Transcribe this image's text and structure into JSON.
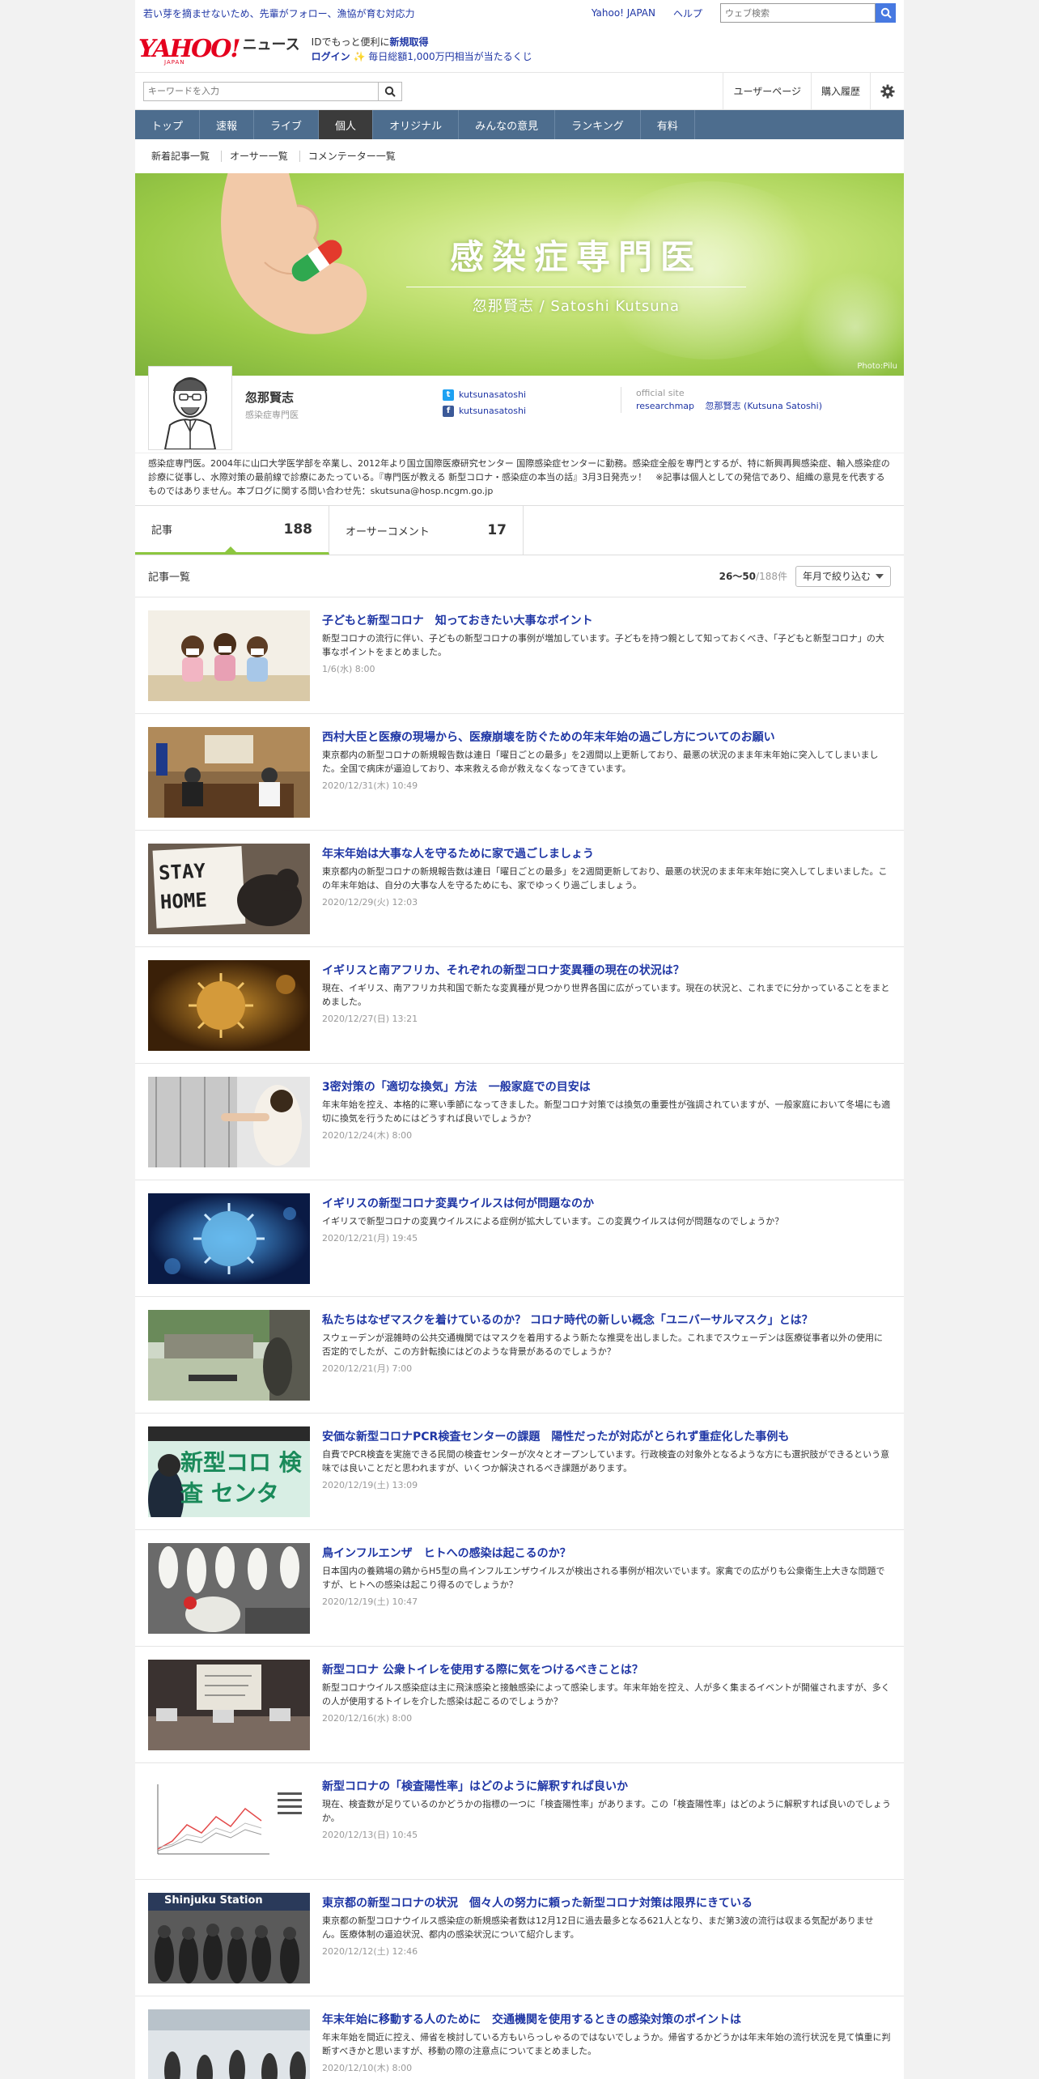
{
  "topbar": {
    "promo": "若い芽を摘ませないため、先輩がフォロー、漁協が育む対応力",
    "yahoo_japan": "Yahoo! JAPAN",
    "help": "ヘルプ",
    "web_search_placeholder": "ウェブ検索"
  },
  "header": {
    "logo_text": "YAHOO!",
    "logo_sub": "JAPAN",
    "news_label": "ニュース",
    "id_prefix": "IDでもっと便利に",
    "id_register": "新規取得",
    "login": "ログイン",
    "lottery": "毎日総額1,000万円相当が当たるくじ"
  },
  "search": {
    "placeholder": "キーワードを入力",
    "user_page": "ユーザーページ",
    "purchase_history": "購入履歴"
  },
  "nav": {
    "items": [
      "トップ",
      "速報",
      "ライブ",
      "個人",
      "オリジナル",
      "みんなの意見",
      "ランキング",
      "有料"
    ],
    "active": "個人"
  },
  "subnav": {
    "items": [
      "新着記事一覧",
      "オーサー一覧",
      "コメンテーター一覧"
    ]
  },
  "banner": {
    "title": "感染症専門医",
    "subtitle": "忽那賢志 / Satoshi Kutsuna",
    "credit": "Photo:Pilu"
  },
  "profile": {
    "name": "忽那賢志",
    "role": "感染症専門医",
    "twitter": "kutsunasatoshi",
    "facebook": "kutsunasatoshi",
    "official_label": "official site",
    "official_links": [
      "researchmap",
      "忽那賢志 (Kutsuna Satoshi)"
    ],
    "bio": "感染症専門医。2004年に山口大学医学部を卒業し、2012年より国立国際医療研究センター 国際感染症センターに勤務。感染症全般を専門とするが、特に新興再興感染症、輸入感染症の診療に従事し、水際対策の最前線で診療にあたっている。『専門医が教える 新型コロナ・感染症の本当の話』3月3日発売ッ！　※記事は個人としての発信であり、組織の意見を代表するものではありません。本ブログに関する問い合わせ先：skutsuna@hosp.ncgm.go.jp"
  },
  "tabs": [
    {
      "label": "記事",
      "count": "188"
    },
    {
      "label": "オーサーコメント",
      "count": "17"
    }
  ],
  "list": {
    "title": "記事一覧",
    "range": "26～50",
    "total": "/188件",
    "filter": "年月で絞り込む"
  },
  "articles": [
    {
      "title": "子どもと新型コロナ　知っておきたい大事なポイント",
      "summary": "新型コロナの流行に伴い、子どもの新型コロナの事例が増加しています。子どもを持つ親として知っておくべき、「子どもと新型コロナ」の大事なポイントをまとめました。",
      "date": "1/6(水) 8:00"
    },
    {
      "title": "西村大臣と医療の現場から、医療崩壊を防ぐための年末年始の過ごし方についてのお願い",
      "summary": "東京都内の新型コロナの新規報告数は連日「曜日ごとの最多」を2週間以上更新しており、最悪の状況のまま年末年始に突入してしまいました。全国で病床が逼迫しており、本来救える命が救えなくなってきています。",
      "date": "2020/12/31(木) 10:49"
    },
    {
      "title": "年末年始は大事な人を守るために家で過ごしましょう",
      "summary": "東京都内の新型コロナの新規報告数は連日「曜日ごとの最多」を2週間更新しており、最悪の状況のまま年末年始に突入してしまいました。この年末年始は、自分の大事な人を守るためにも、家でゆっくり過ごしましょう。",
      "date": "2020/12/29(火) 12:03"
    },
    {
      "title": "イギリスと南アフリカ、それぞれの新型コロナ変異種の現在の状況は？",
      "summary": "現在、イギリス、南アフリカ共和国で新たな変異種が見つかり世界各国に広がっています。現在の状況と、これまでに分かっていることをまとめました。",
      "date": "2020/12/27(日) 13:21"
    },
    {
      "title": "3密対策の「適切な換気」方法　一般家庭での目安は",
      "summary": "年末年始を控え、本格的に寒い季節になってきました。新型コロナ対策では換気の重要性が強調されていますが、一般家庭において冬場にも適切に換気を行うためにはどうすれば良いでしょうか？",
      "date": "2020/12/24(木) 8:00"
    },
    {
      "title": "イギリスの新型コロナ変異ウイルスは何が問題なのか",
      "summary": "イギリスで新型コロナの変異ウイルスによる症例が拡大しています。この変異ウイルスは何が問題なのでしょうか？",
      "date": "2020/12/21(月) 19:45"
    },
    {
      "title": "私たちはなぜマスクを着けているのか？ コロナ時代の新しい概念「ユニバーサルマスク」とは？",
      "summary": "スウェーデンが混雑時の公共交通機関ではマスクを着用するよう新たな推奨を出しました。これまでスウェーデンは医療従事者以外の使用に否定的でしたが、この方針転換にはどのような背景があるのでしょうか？",
      "date": "2020/12/21(月) 7:00"
    },
    {
      "title": "安価な新型コロナPCR検査センターの課題　陽性だったが対応がとられず重症化した事例も",
      "summary": "自費でPCR検査を実施できる民間の検査センターが次々とオープンしています。行政検査の対象外となるような方にも選択肢ができるという意味では良いことだと思われますが、いくつか解決されるべき課題があります。",
      "date": "2020/12/19(土) 13:09"
    },
    {
      "title": "鳥インフルエンザ　ヒトへの感染は起こるのか？",
      "summary": "日本国内の養鶏場の鶏からH5型の鳥インフルエンザウイルスが検出される事例が相次いでいます。家禽での広がりも公衆衛生上大きな問題ですが、ヒトへの感染は起こり得るのでしょうか？",
      "date": "2020/12/19(土) 10:47"
    },
    {
      "title": "新型コロナ 公衆トイレを使用する際に気をつけるべきことは？",
      "summary": "新型コロナウイルス感染症は主に飛沫感染と接触感染によって感染します。年末年始を控え、人が多く集まるイベントが開催されますが、多くの人が使用するトイレを介した感染は起こるのでしょうか？",
      "date": "2020/12/16(水) 8:00"
    },
    {
      "title": "新型コロナの「検査陽性率」はどのように解釈すれば良いか",
      "summary": "現在、検査数が足りているのかどうかの指標の一つに「検査陽性率」があります。この「検査陽性率」はどのように解釈すれば良いのでしょうか。",
      "date": "2020/12/13(日) 10:45"
    },
    {
      "title": "東京都の新型コロナの状況　個々人の努力に頼った新型コロナ対策は限界にきている",
      "summary": "東京都の新型コロナウイルス感染症の新規感染者数は12月12日に過去最多となる621人となり、まだ第3波の流行は収まる気配がありません。医療体制の逼迫状況、都内の感染状況について紹介します。",
      "date": "2020/12/12(土) 12:46"
    },
    {
      "title": "年末年始に移動する人のために　交通機関を使用するときの感染対策のポイントは",
      "summary": "年末年始を間近に控え、帰省を検討している方もいらっしゃるのではないでしょうか。帰省するかどうかは年末年始の流行状況を見て慎重に判断すべきかと思いますが、移動の際の注意点についてまとめました。",
      "date": "2020/12/10(木) 8:00"
    }
  ],
  "thumb_text": {
    "stay_home": "STAY HOME",
    "pcr": "新型コロ 検査 センタ",
    "station": "Shinjuku Station"
  },
  "colors": {
    "nav_bg": "#4d6d8e",
    "link": "#1f36a5",
    "accent_green": "#8cc63f",
    "brand_red": "#e5001e"
  }
}
